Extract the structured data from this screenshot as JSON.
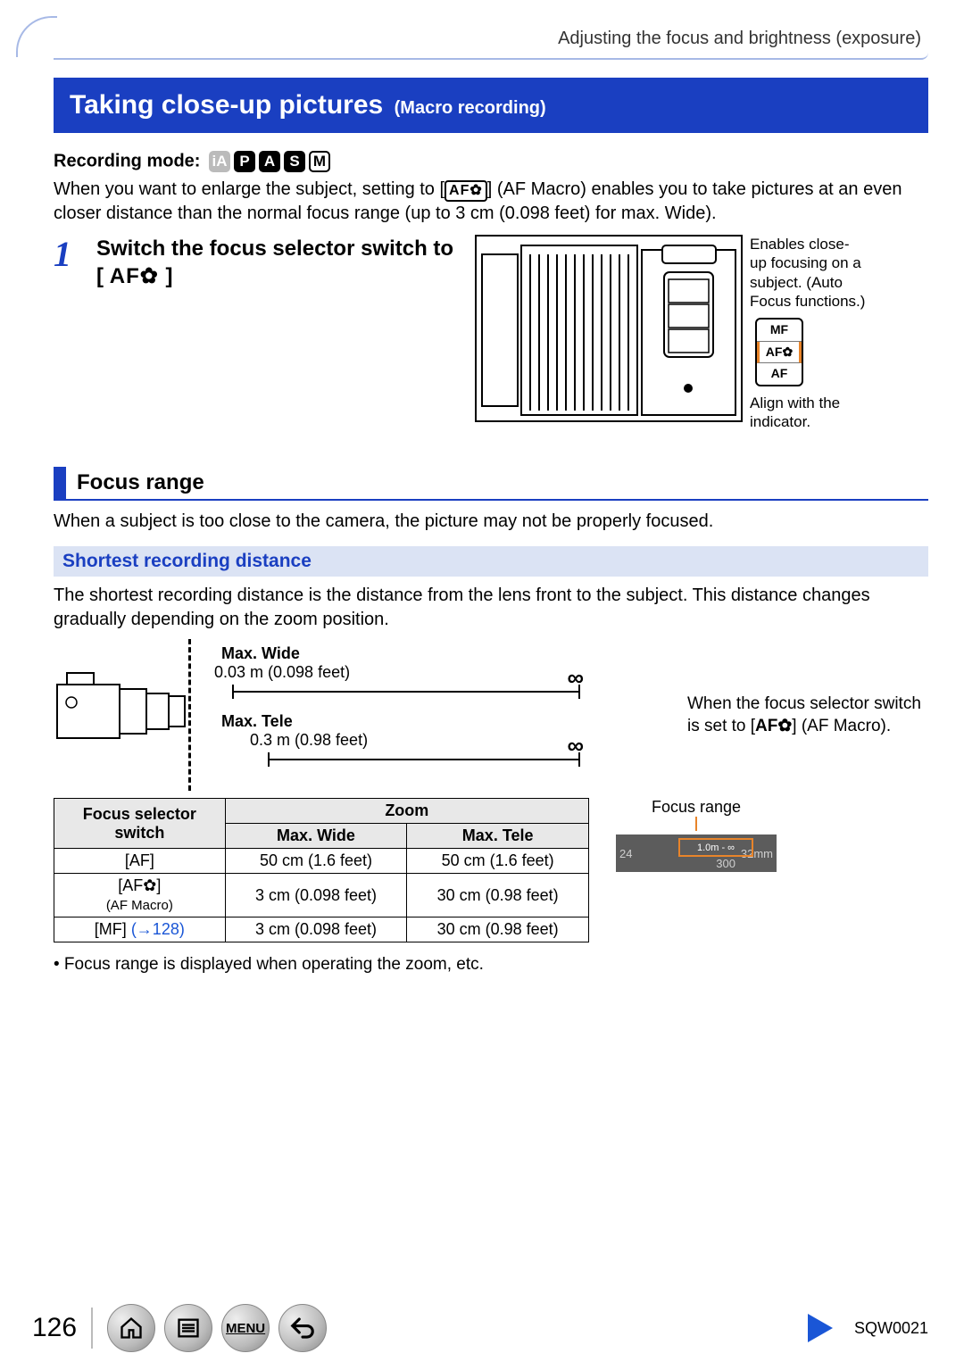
{
  "breadcrumb": "Adjusting the focus and brightness (exposure)",
  "title": {
    "main": "Taking close-up pictures",
    "sub": "(Macro recording)"
  },
  "recording_mode_label": "Recording mode:",
  "mode_icons": [
    "iA",
    "P",
    "A",
    "S",
    "M"
  ],
  "intro_before": "When you want to enlarge the subject, setting to [",
  "intro_icon_text": "AF✿",
  "intro_after": "] (AF Macro) enables you to take pictures at an even closer distance than the normal focus range (up to 3 cm (0.098 feet) for max. Wide).",
  "step1": {
    "num": "1",
    "text_a": "Switch the focus selector switch to [",
    "text_icon": "AF✿",
    "text_b": "]"
  },
  "switch_desc_top": "Enables close-up focusing on a subject. (Auto Focus functions.)",
  "switch_positions": [
    "MF",
    "AF✿",
    "AF"
  ],
  "switch_desc_bottom": "Align with the indicator.",
  "focus_range": {
    "heading": "Focus range",
    "body": "When a subject is too close to the camera, the picture may not be properly focused."
  },
  "shortest": {
    "heading": "Shortest recording distance",
    "body": "The shortest recording distance is the distance from the lens front to the subject. This distance changes gradually depending on the zoom position.",
    "wide_label": "Max. Wide",
    "wide_val": "0.03 m (0.098 feet)",
    "tele_label": "Max. Tele",
    "tele_val": "0.3 m (0.98 feet)",
    "infinity": "∞",
    "note_a": "When the focus selector switch is set to [",
    "note_icon": "AF✿",
    "note_b": "] (AF Macro)."
  },
  "table": {
    "col1_header_a": "Focus selector",
    "col1_header_b": "switch",
    "zoom_header": "Zoom",
    "wide_header": "Max. Wide",
    "tele_header": "Max. Tele",
    "rows": [
      {
        "mode": "[AF]",
        "sub": "",
        "wide": "50 cm (1.6 feet)",
        "tele": "50 cm (1.6 feet)"
      },
      {
        "mode": "[AF✿]",
        "sub": "(AF Macro)",
        "wide": "3 cm (0.098 feet)",
        "tele": "30 cm (0.98 feet)"
      },
      {
        "mode": "[MF]",
        "sub": "",
        "link": "(→128)",
        "wide": "3 cm (0.098 feet)",
        "tele": "30 cm (0.98 feet)"
      }
    ]
  },
  "focus_range_preview_label": "Focus range",
  "preview_text": "1.0m - ∞",
  "preview_scale_left": "24",
  "preview_scale_mid": "300",
  "preview_scale_right": "32mm",
  "bullet": "• Focus range is displayed when operating the zoom, etc.",
  "footer": {
    "page": "126",
    "menu_label": "MENU",
    "doc_id": "SQW0021"
  }
}
